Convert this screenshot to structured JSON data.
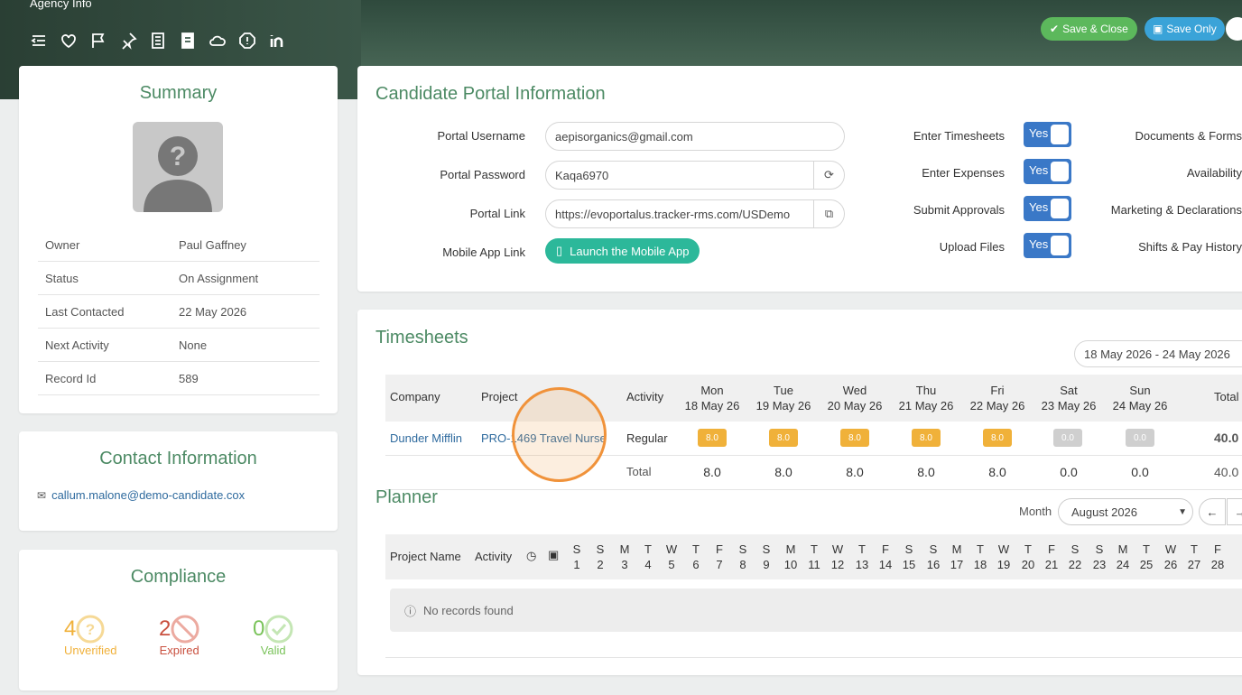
{
  "header": {
    "title": "Agency Info",
    "save_close": "Save & Close",
    "save_only": "Save Only"
  },
  "toolbar": [
    "collapse-icon",
    "heart-icon",
    "flag-icon",
    "pin-icon",
    "notes-icon",
    "document-icon",
    "cloud-icon",
    "alert-icon",
    "linkedin-icon"
  ],
  "summary": {
    "title": "Summary",
    "rows": [
      {
        "k": "Owner",
        "v": "Paul Gaffney"
      },
      {
        "k": "Status",
        "v": "On Assignment"
      },
      {
        "k": "Last Contacted",
        "v": "22 May 2026"
      },
      {
        "k": "Next Activity",
        "v": "None"
      },
      {
        "k": "Record Id",
        "v": "589"
      }
    ]
  },
  "contact": {
    "title": "Contact Information",
    "email": "callum.malone@demo-candidate.cox"
  },
  "compliance": {
    "title": "Compliance",
    "unverified": {
      "n": "4",
      "label": "Unverified",
      "color": "#f0b13a"
    },
    "expired": {
      "n": "2",
      "label": "Expired",
      "color": "#c9503f"
    },
    "valid": {
      "n": "0",
      "label": "Valid",
      "color": "#7ac35a"
    }
  },
  "portal": {
    "title": "Candidate Portal Information",
    "username_label": "Portal Username",
    "username": "aepisorganics@gmail.com",
    "password_label": "Portal Password",
    "password": "Kaqa6970",
    "link_label": "Portal Link",
    "link": "https://evoportalus.tracker-rms.com/USDemo",
    "mobile_label": "Mobile App Link",
    "mobile_button": "Launch the Mobile App",
    "toggles": [
      {
        "label": "Enter Timesheets",
        "value": "Yes"
      },
      {
        "label": "Enter Expenses",
        "value": "Yes"
      },
      {
        "label": "Submit Approvals",
        "value": "Yes"
      },
      {
        "label": "Upload Files",
        "value": "Yes"
      }
    ],
    "right_labels": [
      "Documents & Forms",
      "Availability",
      "Marketing & Declarations",
      "Shifts & Pay History"
    ]
  },
  "timesheets": {
    "title": "Timesheets",
    "range": "18 May 2026 - 24 May 2026",
    "headers": {
      "company": "Company",
      "project": "Project",
      "activity": "Activity",
      "total": "Total"
    },
    "days": [
      {
        "d": "Mon",
        "date": "18 May 26"
      },
      {
        "d": "Tue",
        "date": "19 May 26"
      },
      {
        "d": "Wed",
        "date": "20 May 26"
      },
      {
        "d": "Thu",
        "date": "21 May 26"
      },
      {
        "d": "Fri",
        "date": "22 May 26"
      },
      {
        "d": "Sat",
        "date": "23 May 26"
      },
      {
        "d": "Sun",
        "date": "24 May 26"
      }
    ],
    "row": {
      "company": "Dunder Mifflin",
      "project": "PRO-1469 Travel Nurse",
      "activity": "Regular",
      "hours": [
        "8.0",
        "8.0",
        "8.0",
        "8.0",
        "8.0",
        "0.0",
        "0.0"
      ],
      "total": "40.0"
    },
    "totals": {
      "label": "Total",
      "values": [
        "8.0",
        "8.0",
        "8.0",
        "8.0",
        "8.0",
        "0.0",
        "0.0"
      ],
      "total": "40.0"
    }
  },
  "planner": {
    "title": "Planner",
    "month_label": "Month",
    "month": "August 2026",
    "headers": {
      "project": "Project Name",
      "activity": "Activity"
    },
    "days": [
      [
        "S",
        "1"
      ],
      [
        "S",
        "2"
      ],
      [
        "M",
        "3"
      ],
      [
        "T",
        "4"
      ],
      [
        "W",
        "5"
      ],
      [
        "T",
        "6"
      ],
      [
        "F",
        "7"
      ],
      [
        "S",
        "8"
      ],
      [
        "S",
        "9"
      ],
      [
        "M",
        "10"
      ],
      [
        "T",
        "11"
      ],
      [
        "W",
        "12"
      ],
      [
        "T",
        "13"
      ],
      [
        "F",
        "14"
      ],
      [
        "S",
        "15"
      ],
      [
        "S",
        "16"
      ],
      [
        "M",
        "17"
      ],
      [
        "T",
        "18"
      ],
      [
        "W",
        "19"
      ],
      [
        "T",
        "20"
      ],
      [
        "F",
        "21"
      ],
      [
        "S",
        "22"
      ],
      [
        "S",
        "23"
      ],
      [
        "M",
        "24"
      ],
      [
        "T",
        "25"
      ],
      [
        "W",
        "26"
      ],
      [
        "T",
        "27"
      ],
      [
        "F",
        "28"
      ]
    ],
    "empty": "No records found"
  }
}
